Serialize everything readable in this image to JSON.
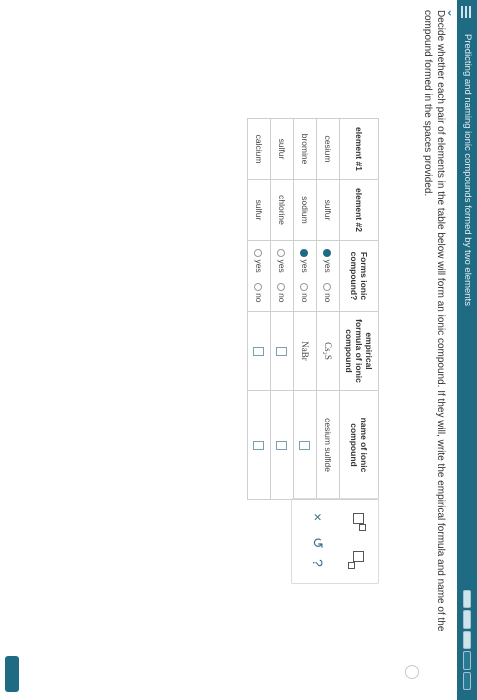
{
  "header": {
    "title": "Predicting and naming ionic compounds formed by two elements"
  },
  "instructions": "Decide whether each pair of elements in the table below will form an ionic compound. If they will, write the empirical formula and name of the compound formed in the spaces provided.",
  "table": {
    "headers": [
      "element #1",
      "element #2",
      "Forms ionic compound?",
      "empirical formula of ionic compound",
      "name of ionic compound"
    ],
    "yes_label": "yes",
    "no_label": "no",
    "rows": [
      {
        "el1": "cesium",
        "el2": "sulfur",
        "forms": "yes",
        "formula": "Cs₂S",
        "name": "cesium sulfide"
      },
      {
        "el1": "bromine",
        "el2": "sodium",
        "forms": "yes",
        "formula": "NaBr",
        "name": ""
      },
      {
        "el1": "sulfur",
        "el2": "chlorine",
        "forms": "",
        "formula": "",
        "name": ""
      },
      {
        "el1": "calcium",
        "el2": "sulfur",
        "forms": "",
        "formula": "",
        "name": ""
      }
    ]
  },
  "tools": {
    "superscript_icon": "superscript-box-icon",
    "subscript_icon": "subscript-box-icon",
    "clear_symbol": "×",
    "undo_symbol": "↺",
    "help_symbol": "?"
  },
  "colors": {
    "header_bg": "#1f6b84",
    "radio_selected": "#1f6b84"
  }
}
